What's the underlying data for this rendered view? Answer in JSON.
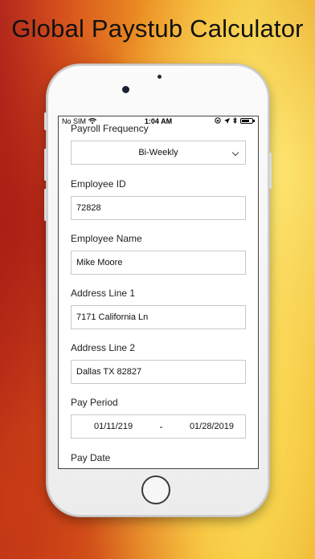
{
  "headline": "Global Paystub Calculator",
  "status_bar": {
    "carrier": "No SIM",
    "time": "1:04 AM",
    "battery_level": 0.75
  },
  "form": {
    "payroll_frequency": {
      "label": "Payroll Frequency",
      "value": "Bi-Weekly"
    },
    "employee_id": {
      "label": "Employee ID",
      "value": "72828"
    },
    "employee_name": {
      "label": "Employee Name",
      "value": "Mike Moore"
    },
    "address_line_1": {
      "label": "Address Line 1",
      "value": "7171 California Ln"
    },
    "address_line_2": {
      "label": "Address Line 2",
      "value": "Dallas TX 82827"
    },
    "pay_period": {
      "label": "Pay Period",
      "start": "01/11/219",
      "separator": "-",
      "end": "01/28/2019"
    },
    "pay_date": {
      "label": "Pay Date"
    }
  }
}
